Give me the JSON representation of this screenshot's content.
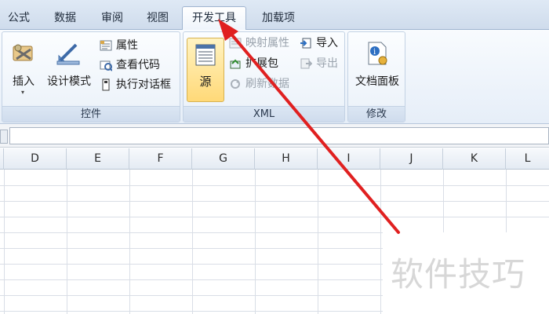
{
  "tabs": [
    {
      "label": "公式",
      "active": false
    },
    {
      "label": "数据",
      "active": false
    },
    {
      "label": "审阅",
      "active": false
    },
    {
      "label": "视图",
      "active": false
    },
    {
      "label": "开发工具",
      "active": true
    },
    {
      "label": "加载项",
      "active": false
    }
  ],
  "groups": {
    "controls": {
      "label": "控件",
      "insert": "插入",
      "design_mode": "设计模式",
      "properties": "属性",
      "view_code": "查看代码",
      "run_dialog": "执行对话框"
    },
    "xml": {
      "label": "XML",
      "source": "源",
      "map_properties": "映射属性",
      "expansion_packs": "扩展包",
      "refresh_data": "刷新数据",
      "import": "导入",
      "export": "导出"
    },
    "modify": {
      "label": "修改",
      "document_panel": "文档面板"
    }
  },
  "columns": [
    "D",
    "E",
    "F",
    "G",
    "H",
    "I",
    "J",
    "K",
    "L"
  ],
  "watermark": "软件技巧",
  "colors": {
    "annotation_arrow": "#e02020",
    "active_button": "#ffd978"
  },
  "icons": [
    "insert-controls-icon",
    "design-mode-icon",
    "properties-icon",
    "view-code-icon",
    "run-dialog-icon",
    "source-icon",
    "map-properties-icon",
    "expansion-packs-icon",
    "refresh-data-icon",
    "import-icon",
    "export-icon",
    "document-panel-icon"
  ]
}
